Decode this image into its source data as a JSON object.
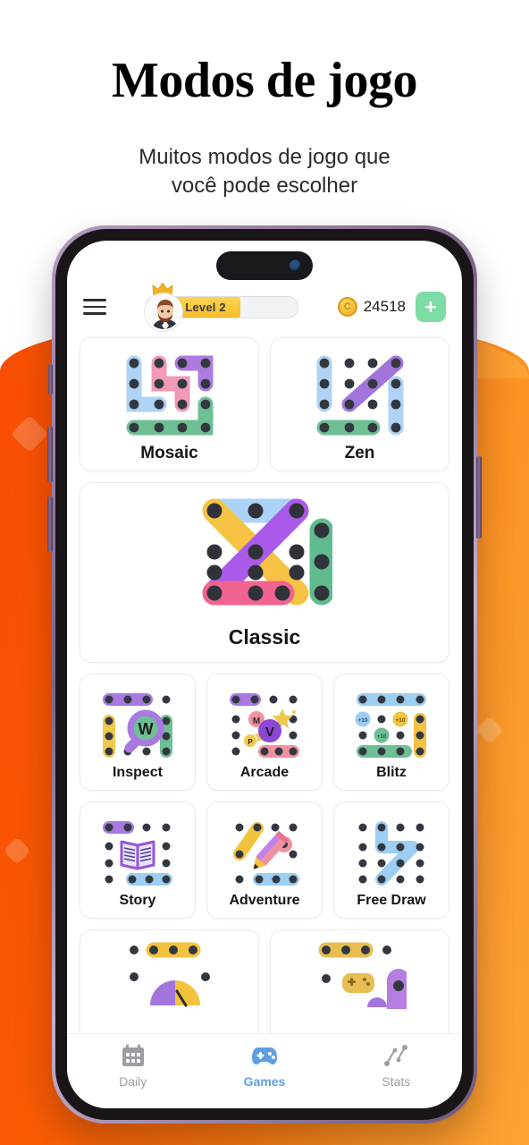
{
  "page": {
    "headline": "Modos de jogo",
    "subheadline": "Muitos modos de jogo que\nvocê pode escolher",
    "accent_orange_left": "#F94C02",
    "accent_orange_right": "#FCA436"
  },
  "app_header": {
    "menu_icon": "hamburger-icon",
    "avatar_icon": "avatar-bearded-man",
    "crown_icon": "crown-icon",
    "level_label": "Level 2",
    "level_progress_percent": 62,
    "coin_icon": "coin-icon",
    "coin_symbol": "C",
    "coin_count": "24518",
    "add_label": "+"
  },
  "game_modes": {
    "row1": [
      {
        "label": "Mosaic",
        "icon": "mosaic-puzzle-icon"
      },
      {
        "label": "Zen",
        "icon": "zen-puzzle-icon"
      }
    ],
    "featured": {
      "label": "Classic",
      "icon": "classic-puzzle-icon"
    },
    "row3": [
      {
        "label": "Inspect",
        "icon": "inspect-magnifier-icon",
        "badge": "W"
      },
      {
        "label": "Arcade",
        "icon": "arcade-wand-icon",
        "badges": [
          "M",
          "V",
          "P"
        ]
      },
      {
        "label": "Blitz",
        "icon": "blitz-bonus-icon",
        "badges": [
          "+10",
          "+10",
          "+10"
        ]
      }
    ],
    "row4": [
      {
        "label": "Story",
        "icon": "story-book-icon"
      },
      {
        "label": "Adventure",
        "icon": "adventure-pencil-icon"
      },
      {
        "label": "Free Draw",
        "icon": "free-draw-icon"
      }
    ],
    "row5": [
      {
        "label": "",
        "icon": "gauge-partial-icon"
      },
      {
        "label": "",
        "icon": "gamepad-partial-icon"
      }
    ]
  },
  "bottom_nav": {
    "items": [
      {
        "label": "Daily",
        "icon": "calendar-icon",
        "active": false
      },
      {
        "label": "Games",
        "icon": "gamepad-icon",
        "active": true
      },
      {
        "label": "Stats",
        "icon": "stats-chart-icon",
        "active": false
      }
    ],
    "active_color": "#5E9FE0",
    "inactive_color": "#9B9EA3"
  }
}
